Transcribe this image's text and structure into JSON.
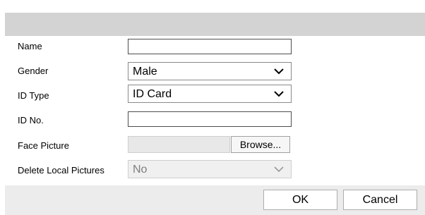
{
  "form": {
    "name": {
      "label": "Name",
      "value": ""
    },
    "gender": {
      "label": "Gender",
      "value": "Male"
    },
    "id_type": {
      "label": "ID Type",
      "value": "ID Card"
    },
    "id_no": {
      "label": "ID No.",
      "value": ""
    },
    "face_picture": {
      "label": "Face Picture",
      "browse_label": "Browse..."
    },
    "delete_local": {
      "label": "Delete Local Pictures",
      "value": "No"
    }
  },
  "footer": {
    "ok_label": "OK",
    "cancel_label": "Cancel"
  },
  "colors": {
    "titlebar": "#d3d3d3",
    "footer": "#ececec",
    "disabled": "#f0f0f0"
  },
  "icons": {
    "dropdown": "chevron-down-icon"
  }
}
